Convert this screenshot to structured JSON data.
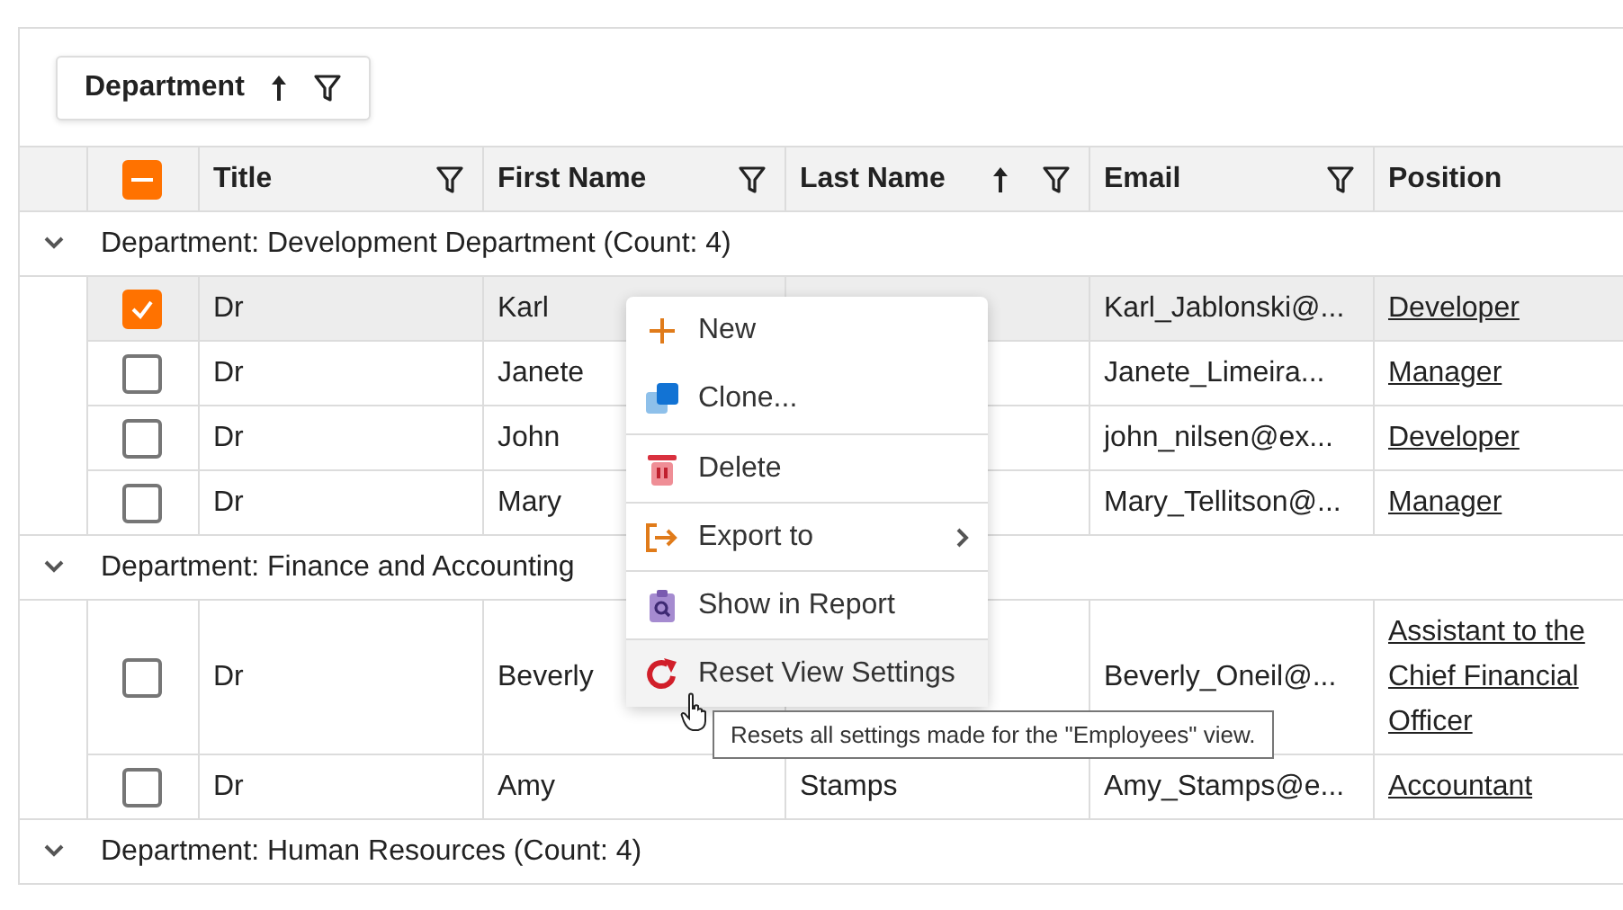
{
  "group_panel": {
    "chips": [
      {
        "label": "Department",
        "sorted": true,
        "filter": true
      }
    ]
  },
  "grid": {
    "select_all": {
      "indeterminate": true
    },
    "columns": [
      {
        "label": "Title",
        "sorted": false,
        "filter": true
      },
      {
        "label": "First Name",
        "sorted": false,
        "filter": true
      },
      {
        "label": "Last Name",
        "sorted": true,
        "filter": true
      },
      {
        "label": "Email",
        "sorted": false,
        "filter": true
      },
      {
        "label": "Position",
        "sorted": false,
        "filter": false
      }
    ],
    "groups": [
      {
        "label": "Department: Development Department (Count: 4)",
        "expanded": true,
        "rows": [
          {
            "checked": true,
            "selected": true,
            "title": "Dr",
            "first_name": "Karl",
            "last_name": "",
            "email": "Karl_Jablonski@...",
            "position": "Developer"
          },
          {
            "checked": false,
            "selected": false,
            "title": "Dr",
            "first_name": "Janete",
            "last_name": "",
            "email": "Janete_Limeira...",
            "position": "Manager"
          },
          {
            "checked": false,
            "selected": false,
            "title": "Dr",
            "first_name": "John",
            "last_name": "",
            "email": "john_nilsen@ex...",
            "position": "Developer"
          },
          {
            "checked": false,
            "selected": false,
            "title": "Dr",
            "first_name": "Mary",
            "last_name": "",
            "email": "Mary_Tellitson@...",
            "position": "Manager"
          }
        ]
      },
      {
        "label": "Department: Finance and Accounting",
        "expanded": true,
        "rows": [
          {
            "checked": false,
            "selected": false,
            "title": "Dr",
            "first_name": "Beverly",
            "last_name": "",
            "email": "Beverly_Oneil@...",
            "position": "Assistant to the Chief Financial Officer"
          },
          {
            "checked": false,
            "selected": false,
            "title": "Dr",
            "first_name": "Amy",
            "last_name": "Stamps",
            "email": "Amy_Stamps@e...",
            "position": "Accountant"
          }
        ]
      },
      {
        "label": "Department: Human Resources (Count: 4)",
        "expanded": true
      }
    ]
  },
  "context_menu": {
    "items": [
      {
        "label": "New",
        "kind": "new",
        "divider_above": false,
        "submenu": false,
        "hovered": false
      },
      {
        "label": "Clone...",
        "kind": "clone",
        "divider_above": false,
        "submenu": false,
        "hovered": false
      },
      {
        "label": "Delete",
        "kind": "delete",
        "divider_above": true,
        "submenu": false,
        "hovered": false
      },
      {
        "label": "Export to",
        "kind": "export",
        "divider_above": true,
        "submenu": true,
        "hovered": false
      },
      {
        "label": "Show in Report",
        "kind": "report",
        "divider_above": true,
        "submenu": false,
        "hovered": false
      },
      {
        "label": "Reset View Settings",
        "kind": "reset",
        "divider_above": true,
        "submenu": false,
        "hovered": true
      }
    ]
  },
  "tooltip": {
    "text": "Resets all settings made for the \"Employees\" view."
  }
}
